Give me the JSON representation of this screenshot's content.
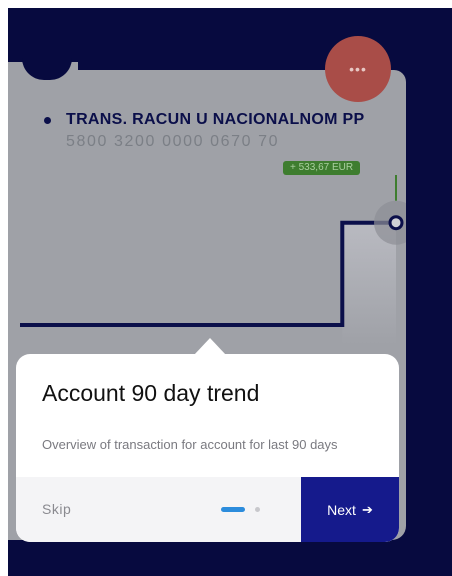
{
  "account": {
    "name": "TRANS. RACUN U NACIONALNOM PP",
    "number": "5800 3200 0000 0670 70",
    "change_badge": "+ 533,67 EUR"
  },
  "menu": {
    "icon": "more-dots-icon",
    "glyph": "•••"
  },
  "chart_data": {
    "type": "line",
    "title": "",
    "xlabel": "",
    "ylabel": "",
    "series": [
      {
        "values": [
          0,
          0,
          0,
          0,
          0,
          0,
          533.67,
          533.67
        ]
      }
    ],
    "x": [
      1,
      2,
      3,
      4,
      5,
      6,
      7,
      8
    ],
    "ylim": [
      0,
      600
    ],
    "line_color": "#0b0f4a",
    "area_fill": "#b9bac1"
  },
  "walkthrough": {
    "title": "Account 90 day trend",
    "description": "Overview of transaction for account for last 90 days",
    "skip_label": "Skip",
    "next_label": "Next",
    "next_icon": "arrow-right-icon",
    "steps_total": 2,
    "step_current": 1
  },
  "colors": {
    "background": "#070a3f",
    "accent_button": "#151a8c",
    "fab": "#a94d48",
    "positive": "#3e7d2f",
    "progress_active": "#2c8cdc"
  }
}
